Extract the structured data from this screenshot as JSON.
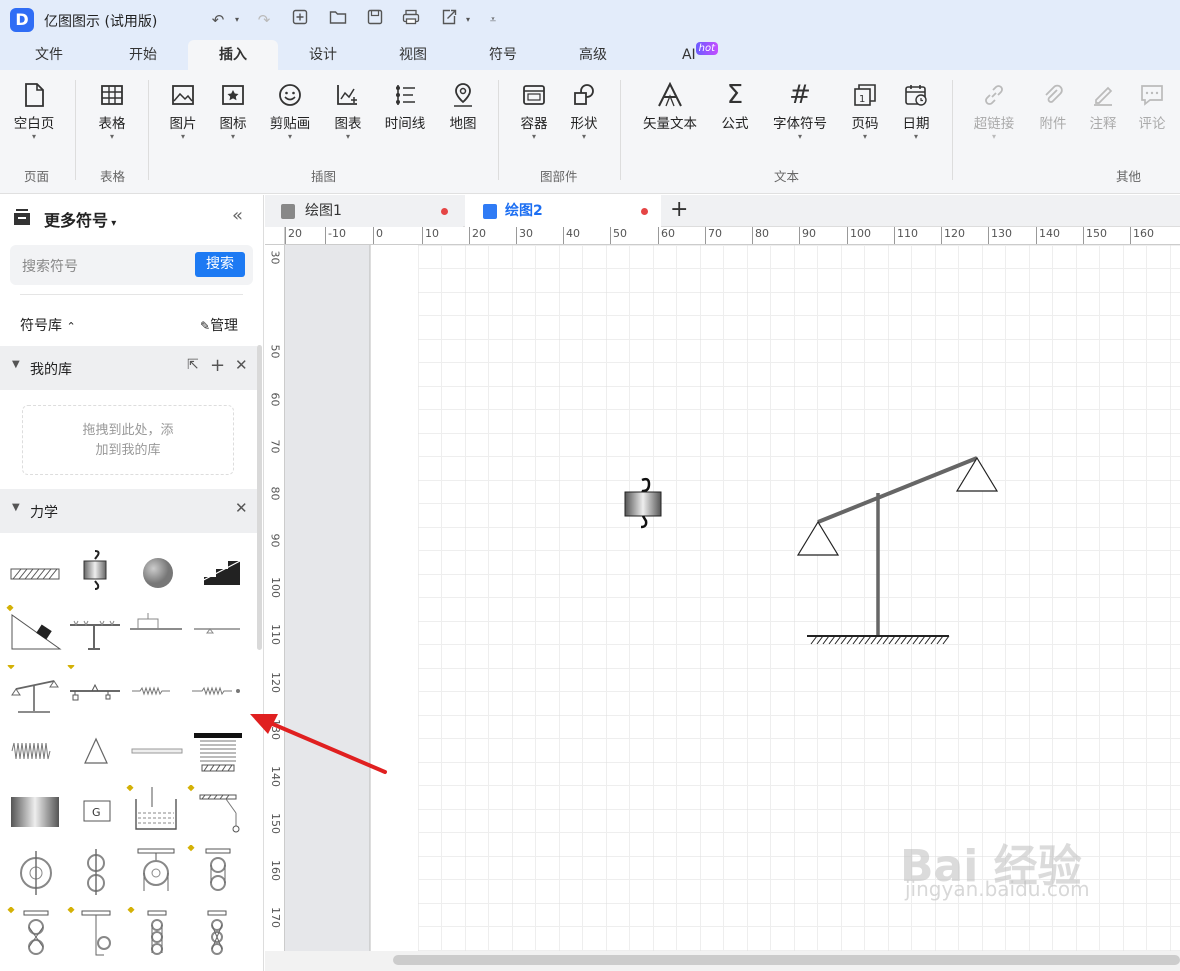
{
  "app": {
    "title": "亿图图示 (试用版)",
    "logo_char": "D"
  },
  "quick_access": [
    "undo-icon",
    "redo-icon",
    "new-icon",
    "open-icon",
    "save-icon",
    "print-icon",
    "export-icon",
    "more-icon"
  ],
  "menu_tabs": [
    {
      "label": "文件"
    },
    {
      "label": "开始"
    },
    {
      "label": "插入",
      "active": true
    },
    {
      "label": "设计"
    },
    {
      "label": "视图"
    },
    {
      "label": "符号"
    },
    {
      "label": "高级"
    },
    {
      "label": "AI",
      "badge": "hot"
    }
  ],
  "ribbon": {
    "groups": [
      {
        "label": "页面"
      },
      {
        "label": "表格"
      },
      {
        "label": "插图"
      },
      {
        "label": "图部件"
      },
      {
        "label": "文本"
      },
      {
        "label": "其他"
      }
    ],
    "buttons": [
      {
        "label": "空白页",
        "icon": "blank-page-icon",
        "dropdown": true
      },
      {
        "label": "表格",
        "icon": "table-icon",
        "dropdown": true
      },
      {
        "label": "图片",
        "icon": "image-icon",
        "dropdown": true
      },
      {
        "label": "图标",
        "icon": "icon-icon",
        "dropdown": true
      },
      {
        "label": "剪贴画",
        "icon": "clipart-icon",
        "dropdown": true
      },
      {
        "label": "图表",
        "icon": "chart-icon",
        "dropdown": true
      },
      {
        "label": "时间线",
        "icon": "timeline-icon",
        "dropdown": false
      },
      {
        "label": "地图",
        "icon": "map-icon",
        "dropdown": false
      },
      {
        "label": "容器",
        "icon": "container-icon",
        "dropdown": true
      },
      {
        "label": "形状",
        "icon": "shape-icon",
        "dropdown": true
      },
      {
        "label": "矢量文本",
        "icon": "vector-text-icon",
        "dropdown": false
      },
      {
        "label": "公式",
        "icon": "formula-icon",
        "dropdown": false
      },
      {
        "label": "字体符号",
        "icon": "font-symbol-icon",
        "dropdown": true
      },
      {
        "label": "页码",
        "icon": "page-number-icon",
        "dropdown": true
      },
      {
        "label": "日期",
        "icon": "date-icon",
        "dropdown": true
      },
      {
        "label": "超链接",
        "icon": "hyperlink-icon",
        "dropdown": true,
        "disabled": true
      },
      {
        "label": "附件",
        "icon": "attachment-icon",
        "dropdown": false,
        "disabled": true
      },
      {
        "label": "注释",
        "icon": "annotation-icon",
        "dropdown": false,
        "disabled": true
      },
      {
        "label": "评论",
        "icon": "comment-icon",
        "dropdown": false,
        "disabled": true
      }
    ]
  },
  "sidebar": {
    "title": "更多符号",
    "search_placeholder": "搜索符号",
    "search_button": "搜索",
    "library_label": "符号库",
    "manage_label": "管理",
    "my_library": {
      "title": "我的库",
      "drop_hint_line1": "拖拽到此处，添",
      "drop_hint_line2": "加到我的库"
    },
    "mechanics": {
      "title": "力学",
      "symbols": [
        "hatched-ground",
        "hanging-weight",
        "ball",
        "stair-slope",
        "incline-block",
        "truss-beam",
        "simple-beam",
        "lever-beam",
        "balance-scale",
        "lever-weights",
        "spring-small",
        "spring-damper",
        "coil-spring",
        "triangle-support",
        "rod",
        "compressed-spring",
        "gradient-block",
        "g-block",
        "water-tank",
        "pendulum",
        "pulley-single",
        "pulley-double",
        "pulley-fixed",
        "pulley-block",
        "pulley-system-1",
        "pulley-system-2",
        "pulley-system-3",
        "pulley-system-4"
      ]
    }
  },
  "documents": {
    "tabs": [
      {
        "label": "绘图1",
        "active": false
      },
      {
        "label": "绘图2",
        "active": true
      }
    ],
    "add_label": "+"
  },
  "ruler": {
    "h_ticks": [
      "20",
      "-10",
      "0",
      "10",
      "20",
      "30",
      "40",
      "50",
      "60",
      "70",
      "80",
      "90",
      "100",
      "110",
      "120",
      "130",
      "140",
      "150",
      "160"
    ],
    "v_ticks": [
      "30",
      "50",
      "60",
      "70",
      "80",
      "90",
      "100",
      "110",
      "120",
      "130",
      "140",
      "150",
      "160",
      "170"
    ]
  },
  "watermark": {
    "line1": "Bai 经验",
    "line2": "jingyan.baidu.com"
  }
}
